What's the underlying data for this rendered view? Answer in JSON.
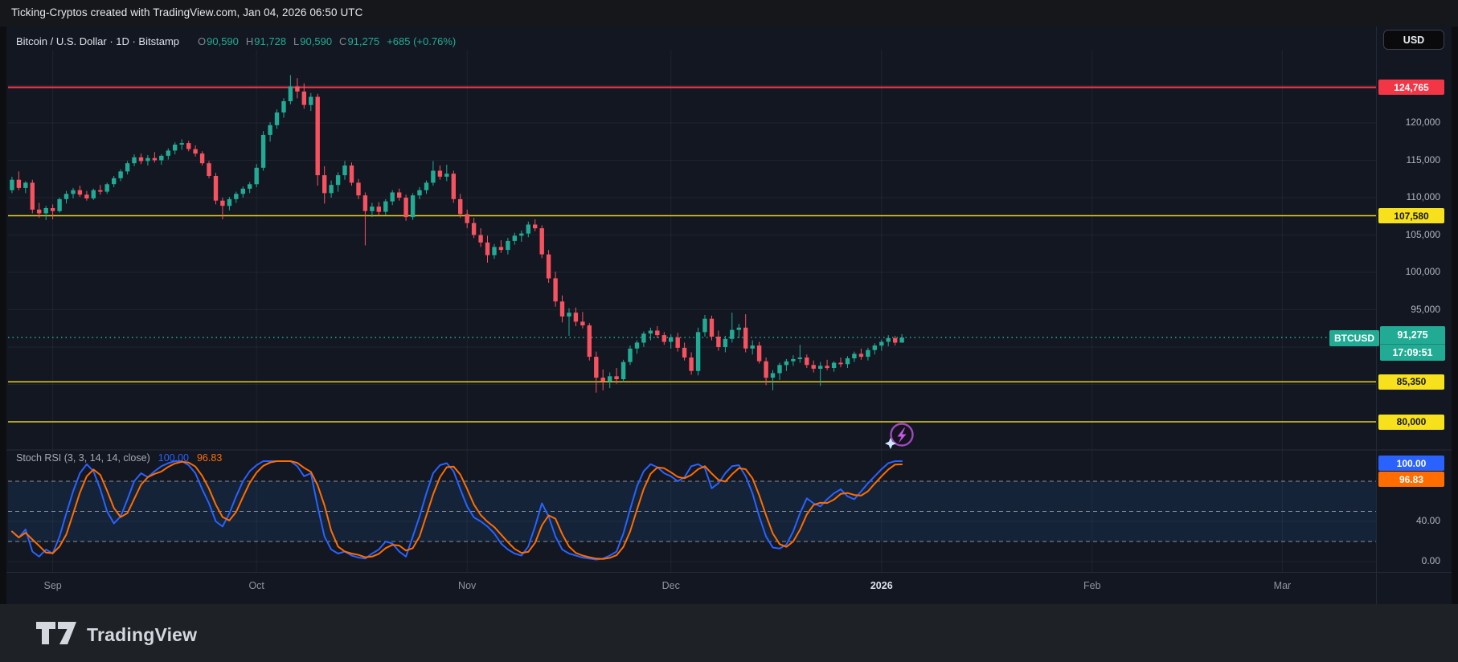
{
  "top_bar": {
    "text": "Ticking-Cryptos created with TradingView.com, Jan 04, 2026 06:50 UTC"
  },
  "header": {
    "instrument": "Bitcoin / U.S. Dollar · 1D · Bitstamp",
    "o_label": "O",
    "o": "90,590",
    "h_label": "H",
    "h": "91,728",
    "l_label": "L",
    "l": "90,590",
    "c_label": "C",
    "c": "91,275",
    "change": "+685 (+0.76%)",
    "currency": "USD"
  },
  "price_scale": {
    "ath": "124,765",
    "r1": "107,580",
    "s1": "85,350",
    "s2": "80,000",
    "symbol_tag": "BTCUSD",
    "last": "91,275",
    "countdown": "17:09:51",
    "ticks": [
      "120,000",
      "115,000",
      "110,000",
      "105,000",
      "100,000",
      "95,000"
    ],
    "tick_values": [
      120000,
      115000,
      110000,
      105000,
      100000,
      95000
    ]
  },
  "indicator_scale": {
    "k": "100.00",
    "d": "96.83",
    "ticks": [
      "40.00",
      "0.00"
    ],
    "tick_values": [
      40,
      0
    ]
  },
  "time_axis": {
    "labels": [
      "Sep",
      "Oct",
      "Nov",
      "Dec",
      "2026",
      "Feb",
      "Mar"
    ]
  },
  "footer": {
    "brand": "TradingView"
  },
  "colors": {
    "up": "#22ab94",
    "down": "#f7525f",
    "ath_line": "#f23645",
    "level_line": "#e8d117",
    "level_label_bg": "#f6e11c",
    "last_price": "#22ab94",
    "k_line": "#2962ff",
    "d_line": "#ff6d00",
    "band_fill": "rgba(33,150,243,0.10)",
    "grid": "rgba(255,255,255,0.055)",
    "dashed_band": "rgba(178,183,198,0.75)"
  },
  "chart_data": {
    "type": "candlestick",
    "title": "Bitcoin / U.S. Dollar, 1D, Bitstamp",
    "ylim": [
      76500,
      129800
    ],
    "levels": [
      {
        "price": 124765,
        "label": "124,765",
        "kind": "resistance-red"
      },
      {
        "price": 107580,
        "label": "107,580",
        "kind": "level-yellow"
      },
      {
        "price": 85350,
        "label": "85,350",
        "kind": "level-yellow"
      },
      {
        "price": 80000,
        "label": "80,000",
        "kind": "level-yellow"
      }
    ],
    "last_price": {
      "price": 91275,
      "countdown": "17:09:51",
      "change": 685,
      "change_pct": 0.76
    },
    "x_labels": [
      "Sep",
      "Oct",
      "Nov",
      "Dec",
      "2026",
      "Feb",
      "Mar"
    ],
    "candles": [
      [
        "Aug 26",
        111000,
        112800,
        110600,
        112400
      ],
      [
        "Aug 27",
        112400,
        113500,
        111000,
        111300
      ],
      [
        "Aug 28",
        111300,
        112200,
        110600,
        112000
      ],
      [
        "Aug 29",
        112000,
        112400,
        107900,
        108400
      ],
      [
        "Aug 30",
        108400,
        109300,
        107300,
        107900
      ],
      [
        "Aug 31",
        107900,
        108900,
        107000,
        108600
      ],
      [
        "Sep 1",
        108600,
        109100,
        107100,
        108200
      ],
      [
        "Sep 2",
        108200,
        110000,
        108000,
        109800
      ],
      [
        "Sep 3",
        109800,
        110900,
        109200,
        110500
      ],
      [
        "Sep 4",
        110500,
        111300,
        109900,
        111000
      ],
      [
        "Sep 5",
        111000,
        111600,
        110100,
        110400
      ],
      [
        "Sep 6",
        110400,
        110900,
        109600,
        109900
      ],
      [
        "Sep 7",
        109900,
        111200,
        109700,
        111000
      ],
      [
        "Sep 8",
        111000,
        111700,
        110400,
        110800
      ],
      [
        "Sep 9",
        110800,
        112000,
        110500,
        111800
      ],
      [
        "Sep 10",
        111800,
        112900,
        111400,
        112600
      ],
      [
        "Sep 11",
        112600,
        113800,
        112200,
        113500
      ],
      [
        "Sep 12",
        113500,
        114900,
        113100,
        114600
      ],
      [
        "Sep 13",
        114600,
        115800,
        114200,
        115400
      ],
      [
        "Sep 14",
        115400,
        115900,
        114500,
        114900
      ],
      [
        "Sep 15",
        114900,
        115700,
        114300,
        115300
      ],
      [
        "Sep 16",
        115300,
        116100,
        114700,
        115000
      ],
      [
        "Sep 17",
        115000,
        115800,
        114400,
        115600
      ],
      [
        "Sep 18",
        115600,
        116600,
        115100,
        116300
      ],
      [
        "Sep 19",
        116300,
        117400,
        115800,
        117100
      ],
      [
        "Sep 20",
        117100,
        117800,
        116400,
        117300
      ],
      [
        "Sep 21",
        117300,
        117600,
        116200,
        116500
      ],
      [
        "Sep 22",
        116500,
        117000,
        115500,
        115900
      ],
      [
        "Sep 23",
        115900,
        116200,
        114300,
        114600
      ],
      [
        "Sep 24",
        114600,
        114900,
        112600,
        112900
      ],
      [
        "Sep 25",
        112900,
        113300,
        109100,
        109600
      ],
      [
        "Sep 26",
        109600,
        110000,
        107100,
        108900
      ],
      [
        "Sep 27",
        108900,
        110100,
        108300,
        109800
      ],
      [
        "Sep 28",
        109800,
        110800,
        109300,
        110500
      ],
      [
        "Sep 29",
        110500,
        111500,
        110000,
        111200
      ],
      [
        "Sep 30",
        111200,
        112100,
        110600,
        111800
      ],
      [
        "Oct 1",
        111800,
        114500,
        111400,
        114000
      ],
      [
        "Oct 2",
        114000,
        118900,
        113600,
        118400
      ],
      [
        "Oct 3",
        118400,
        120100,
        117500,
        119700
      ],
      [
        "Oct 4",
        119700,
        121800,
        119200,
        121400
      ],
      [
        "Oct 5",
        121400,
        123300,
        120700,
        122900
      ],
      [
        "Oct 6",
        122900,
        126400,
        122500,
        124900
      ],
      [
        "Oct 7",
        124900,
        126000,
        123300,
        124200
      ],
      [
        "Oct 8",
        124200,
        125300,
        121900,
        122400
      ],
      [
        "Oct 9",
        122400,
        124000,
        121600,
        123500
      ],
      [
        "Oct 10",
        123500,
        123900,
        111600,
        113000
      ],
      [
        "Oct 11",
        113000,
        114200,
        109200,
        110600
      ],
      [
        "Oct 12",
        110600,
        112300,
        110000,
        111700
      ],
      [
        "Oct 13",
        111700,
        113400,
        110800,
        113000
      ],
      [
        "Oct 14",
        113000,
        114900,
        112400,
        114300
      ],
      [
        "Oct 15",
        114300,
        114700,
        111600,
        112000
      ],
      [
        "Oct 16",
        112000,
        112500,
        109800,
        110300
      ],
      [
        "Oct 17",
        110300,
        110700,
        103600,
        108200
      ],
      [
        "Oct 18",
        108200,
        109300,
        107400,
        108800
      ],
      [
        "Oct 19",
        108800,
        109400,
        107600,
        108100
      ],
      [
        "Oct 20",
        108100,
        109800,
        107700,
        109500
      ],
      [
        "Oct 21",
        109500,
        111000,
        109000,
        110700
      ],
      [
        "Oct 22",
        110700,
        111200,
        109600,
        110000
      ],
      [
        "Oct 23",
        110000,
        110400,
        106900,
        107400
      ],
      [
        "Oct 24",
        107400,
        110600,
        107000,
        110300
      ],
      [
        "Oct 25",
        110300,
        111400,
        109800,
        111000
      ],
      [
        "Oct 26",
        111000,
        112300,
        110500,
        112000
      ],
      [
        "Oct 27",
        112000,
        114900,
        111600,
        113600
      ],
      [
        "Oct 28",
        113600,
        114300,
        112400,
        112800
      ],
      [
        "Oct 29",
        112800,
        114400,
        112200,
        113200
      ],
      [
        "Oct 30",
        113200,
        113600,
        109300,
        109800
      ],
      [
        "Oct 31",
        109800,
        110500,
        107300,
        107800
      ],
      [
        "Nov 1",
        107800,
        108400,
        105900,
        106600
      ],
      [
        "Nov 2",
        106600,
        107300,
        104600,
        105000
      ],
      [
        "Nov 3",
        105000,
        105900,
        103400,
        104000
      ],
      [
        "Nov 4",
        104000,
        104900,
        101300,
        102300
      ],
      [
        "Nov 5",
        102300,
        103800,
        101800,
        103400
      ],
      [
        "Nov 6",
        103400,
        104300,
        102600,
        103000
      ],
      [
        "Nov 7",
        103000,
        104600,
        102400,
        104200
      ],
      [
        "Nov 8",
        104200,
        105300,
        103700,
        104900
      ],
      [
        "Nov 9",
        104900,
        105600,
        104100,
        105200
      ],
      [
        "Nov 10",
        105200,
        106800,
        104700,
        106400
      ],
      [
        "Nov 11",
        106400,
        107100,
        105500,
        105900
      ],
      [
        "Nov 12",
        105900,
        106300,
        101900,
        102400
      ],
      [
        "Nov 13",
        102400,
        103000,
        98600,
        99200
      ],
      [
        "Nov 14",
        99200,
        100100,
        95400,
        96100
      ],
      [
        "Nov 15",
        96100,
        96900,
        93300,
        94100
      ],
      [
        "Nov 16",
        94100,
        95200,
        91500,
        94600
      ],
      [
        "Nov 17",
        94600,
        95300,
        92800,
        93400
      ],
      [
        "Nov 18",
        93400,
        94700,
        92500,
        92900
      ],
      [
        "Nov 19",
        92900,
        93200,
        88200,
        88700
      ],
      [
        "Nov 20",
        88700,
        89400,
        83900,
        85900
      ],
      [
        "Nov 21",
        85900,
        87000,
        84200,
        85400
      ],
      [
        "Nov 22",
        85400,
        86600,
        84500,
        86100
      ],
      [
        "Nov 23",
        86100,
        87200,
        85100,
        85700
      ],
      [
        "Nov 24",
        85700,
        88300,
        85300,
        88000
      ],
      [
        "Nov 25",
        88000,
        90200,
        87600,
        89800
      ],
      [
        "Nov 26",
        89800,
        90900,
        89100,
        90600
      ],
      [
        "Nov 27",
        90600,
        92100,
        90000,
        91800
      ],
      [
        "Nov 28",
        91800,
        92600,
        90900,
        92200
      ],
      [
        "Nov 29",
        92200,
        92800,
        91200,
        91600
      ],
      [
        "Nov 30",
        91600,
        92000,
        90300,
        90700
      ],
      [
        "Dec 1",
        90700,
        91700,
        89800,
        91300
      ],
      [
        "Dec 2",
        91300,
        91900,
        89400,
        89900
      ],
      [
        "Dec 3",
        89900,
        90600,
        88200,
        88600
      ],
      [
        "Dec 4",
        88600,
        89300,
        86300,
        86800
      ],
      [
        "Dec 5",
        86800,
        92600,
        86200,
        92000
      ],
      [
        "Dec 6",
        92000,
        94300,
        91400,
        93800
      ],
      [
        "Dec 7",
        93800,
        94200,
        90900,
        91400
      ],
      [
        "Dec 8",
        91400,
        92200,
        89500,
        90000
      ],
      [
        "Dec 9",
        90000,
        91500,
        89300,
        91100
      ],
      [
        "Dec 10",
        91100,
        94600,
        90600,
        92300
      ],
      [
        "Dec 11",
        92300,
        93100,
        91200,
        92600
      ],
      [
        "Dec 12",
        92600,
        94400,
        89300,
        89800
      ],
      [
        "Dec 13",
        89800,
        90900,
        89000,
        90200
      ],
      [
        "Dec 14",
        90200,
        90700,
        87800,
        88100
      ],
      [
        "Dec 15",
        88100,
        88600,
        84900,
        85900
      ],
      [
        "Dec 16",
        85900,
        86900,
        84200,
        86500
      ],
      [
        "Dec 17",
        86500,
        87900,
        85600,
        87600
      ],
      [
        "Dec 18",
        87600,
        88400,
        86800,
        88100
      ],
      [
        "Dec 19",
        88100,
        88900,
        87500,
        88400
      ],
      [
        "Dec 20",
        88400,
        90300,
        87900,
        88600
      ],
      [
        "Dec 21",
        88600,
        89000,
        87200,
        87600
      ],
      [
        "Dec 22",
        87600,
        88200,
        86600,
        87100
      ],
      [
        "Dec 23",
        87100,
        88000,
        84800,
        87500
      ],
      [
        "Dec 24",
        87500,
        88300,
        86900,
        87200
      ],
      [
        "Dec 25",
        87200,
        88100,
        86700,
        87900
      ],
      [
        "Dec 26",
        87900,
        88600,
        87300,
        87700
      ],
      [
        "Dec 27",
        87700,
        88800,
        87200,
        88500
      ],
      [
        "Dec 28",
        88500,
        89400,
        88000,
        89100
      ],
      [
        "Dec 29",
        89100,
        89800,
        88300,
        88700
      ],
      [
        "Dec 30",
        88700,
        89900,
        88200,
        89600
      ],
      [
        "Dec 31",
        89600,
        90500,
        89000,
        90200
      ],
      [
        "Jan 1",
        90200,
        91000,
        89500,
        90700
      ],
      [
        "Jan 2",
        90700,
        91600,
        90100,
        91200
      ],
      [
        "Jan 3",
        91200,
        91500,
        90200,
        90590
      ],
      [
        "Jan 4",
        90590,
        91728,
        90590,
        91275
      ]
    ],
    "indicator": {
      "type": "line",
      "name": "Stoch RSI (3, 3, 14, 14, close)",
      "k_last": 100.0,
      "d_last": 96.83,
      "bands": {
        "upper": 80,
        "middle": 50,
        "lower": 20
      },
      "range": [
        0,
        100
      ],
      "k": [
        30,
        24,
        32,
        10,
        5,
        12,
        8,
        25,
        48,
        70,
        88,
        97,
        90,
        72,
        50,
        38,
        45,
        62,
        80,
        88,
        84,
        90,
        95,
        98,
        100,
        100,
        96,
        88,
        72,
        58,
        40,
        35,
        48,
        65,
        80,
        90,
        96,
        100,
        100,
        100,
        100,
        100,
        95,
        85,
        88,
        55,
        25,
        12,
        8,
        10,
        6,
        4,
        3,
        8,
        12,
        20,
        18,
        10,
        5,
        25,
        45,
        68,
        88,
        96,
        98,
        90,
        72,
        55,
        44,
        40,
        35,
        28,
        18,
        12,
        8,
        6,
        15,
        35,
        58,
        45,
        25,
        12,
        8,
        6,
        4,
        3,
        2,
        3,
        6,
        10,
        28,
        52,
        75,
        90,
        97,
        94,
        88,
        85,
        80,
        84,
        95,
        97,
        93,
        73,
        78,
        88,
        95,
        96,
        85,
        68,
        45,
        25,
        14,
        13,
        17,
        30,
        48,
        63,
        58,
        55,
        62,
        68,
        72,
        65,
        62,
        70,
        78,
        85,
        92,
        98,
        100,
        100
      ],
      "d_smoothing": "sma3 of k"
    }
  }
}
